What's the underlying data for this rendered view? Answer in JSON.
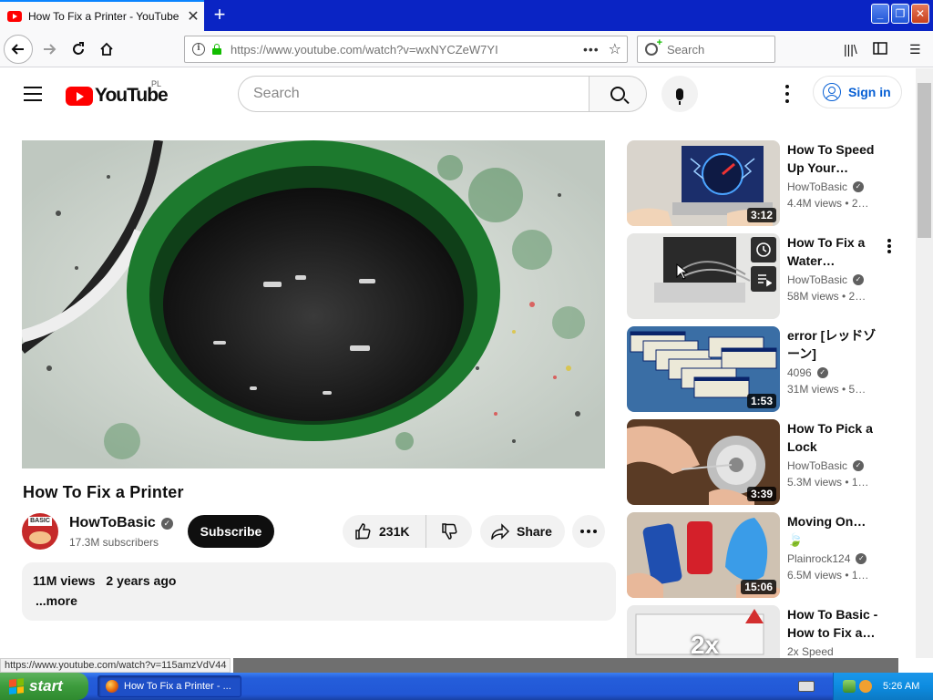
{
  "browser": {
    "tab_title": "How To Fix a Printer - YouTube",
    "url": "https://www.youtube.com/watch?v=wxNYCZeW7YI",
    "search_placeholder": "Search",
    "status_url": "https://www.youtube.com/watch?v=115amzVdV44"
  },
  "header": {
    "logo_text": "YouTube",
    "country": "PL",
    "search_placeholder": "Search",
    "signin_label": "Sign in"
  },
  "video": {
    "title": "How To Fix a Printer",
    "channel": "HowToBasic",
    "subscribers": "17.3M subscribers",
    "subscribe_label": "Subscribe",
    "likes": "231K",
    "share_label": "Share",
    "views": "11M views",
    "age": "2 years ago",
    "more_label": "...more",
    "avatar_text": "BASIC"
  },
  "recommendations": [
    {
      "title": "How To Speed Up Your…",
      "channel": "HowToBasic",
      "verified": true,
      "views": "4.4M views • 2…",
      "duration": "3:12"
    },
    {
      "title": "How To Fix a Water…",
      "channel": "HowToBasic",
      "verified": true,
      "views": "58M views • 2…",
      "duration": ""
    },
    {
      "title": "error [レッドゾーン]",
      "channel": "4096",
      "verified": true,
      "views": "31M views • 5…",
      "duration": "1:53"
    },
    {
      "title": "How To Pick a Lock",
      "channel": "HowToBasic",
      "verified": true,
      "views": "5.3M views • 1…",
      "duration": "3:39"
    },
    {
      "title": "Moving On…",
      "channel": "Plainrock124",
      "verified": true,
      "views": "6.5M views • 1…",
      "duration": "15:06"
    },
    {
      "title": "How To Basic - How to Fix a…",
      "channel": "2x Speed",
      "verified": false,
      "views": "",
      "duration": "",
      "overlay": "2x"
    }
  ],
  "taskbar": {
    "start_label": "start",
    "task_label": "How To Fix a Printer - ...",
    "clock": "5:26 AM"
  },
  "colors": {
    "brand_red": "#ff0000",
    "link_blue": "#065fd4",
    "xp_blue": "#245edb",
    "xp_green": "#3c9b3c"
  }
}
